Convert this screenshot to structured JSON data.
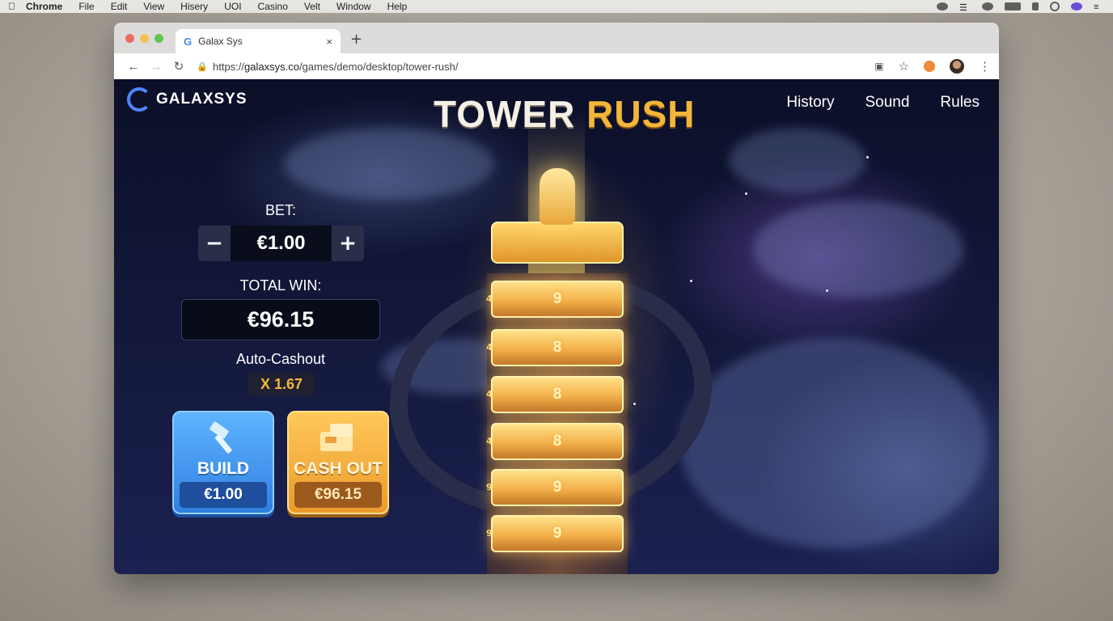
{
  "menubar": {
    "apple": "",
    "items": [
      "Chrome",
      "File",
      "Edit",
      "View",
      "Hisery",
      "UOI",
      "Casino",
      "Velt",
      "Window",
      "Help"
    ]
  },
  "browser": {
    "tab_title": "Galax Sys",
    "tab_close": "×",
    "new_tab": "+",
    "url_prefix": "https://",
    "url_host": "galaxsys.co",
    "url_path": "/games/demo/desktop/tower-rush/"
  },
  "game": {
    "logo_text": "GALAXSYS",
    "title_part1": "TOWER",
    "title_part2": "RUSH",
    "nav": [
      "History",
      "Sound",
      "Rules"
    ],
    "bet_label": "BET:",
    "bet_value": "€1.00",
    "minus": "−",
    "plus": "+",
    "total_win_label": "TOTAL WIN:",
    "total_win_value": "€96.15",
    "auto_cashout_label": "Auto-Cashout",
    "auto_cashout_value": "X 1.67",
    "build_label": "BUILD",
    "build_amount": "€1.00",
    "cashout_label": "CASH OUT",
    "cashout_amount": "€96.15",
    "floors": [
      "9",
      "8",
      "8",
      "8",
      "9",
      "9"
    ],
    "floor_side_marks": [
      "4",
      "4",
      "4",
      "4",
      "9",
      "9"
    ]
  },
  "colors": {
    "accent_gold": "#f2b63a",
    "build_blue": "#2f7fe0",
    "cashout_orange": "#eb9a2a",
    "logo_blue": "#4f86ff"
  }
}
